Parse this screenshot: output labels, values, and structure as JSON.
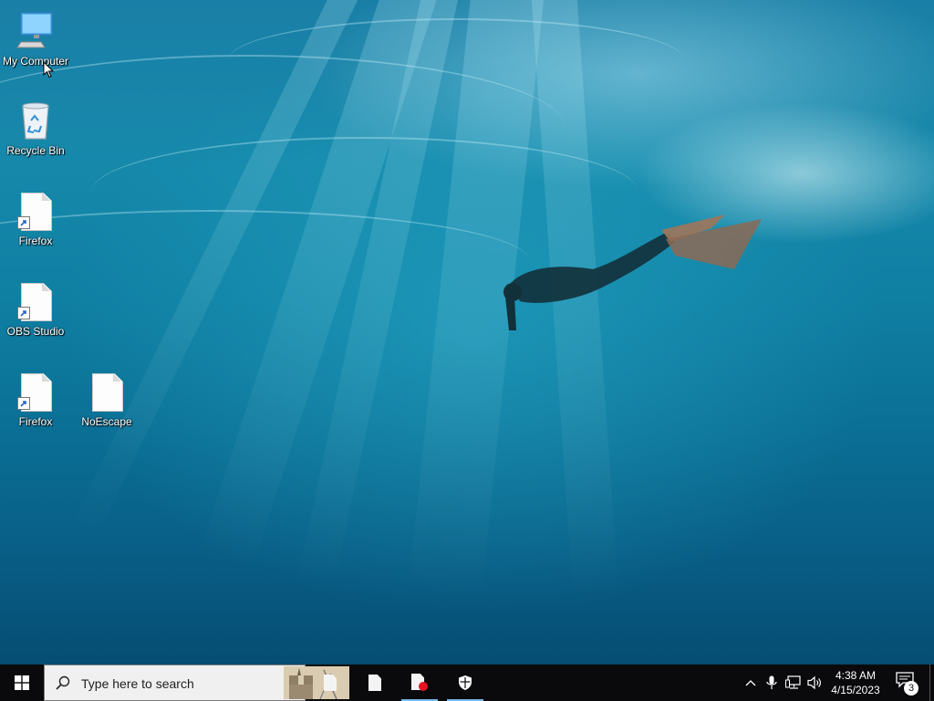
{
  "desktop": {
    "icons": [
      {
        "label": "My Computer",
        "icon": "computer-icon"
      },
      {
        "label": "Recycle Bin",
        "icon": "recycle-bin-icon"
      },
      {
        "label": "Firefox",
        "icon": "file-shortcut-icon"
      },
      {
        "label": "OBS Studio",
        "icon": "file-shortcut-icon"
      },
      {
        "label": "Firefox",
        "icon": "file-shortcut-icon"
      },
      {
        "label": "NoEscape",
        "icon": "file-icon"
      }
    ]
  },
  "taskbar": {
    "search": {
      "placeholder": "Type here to search"
    },
    "apps": [
      {
        "icon": "file-icon",
        "active": false
      },
      {
        "icon": "file-icon",
        "active": false
      },
      {
        "icon": "file-record-icon",
        "active": true
      },
      {
        "icon": "shield-icon",
        "active": true
      }
    ],
    "tray": {
      "time": "4:38 AM",
      "date": "4/15/2023",
      "notification_count": "3"
    }
  },
  "colors": {
    "taskbar_bg": "#0a0a0d",
    "active_underline": "#76b9ed",
    "search_bg": "#f0f0f0",
    "record_dot": "#e81123"
  }
}
